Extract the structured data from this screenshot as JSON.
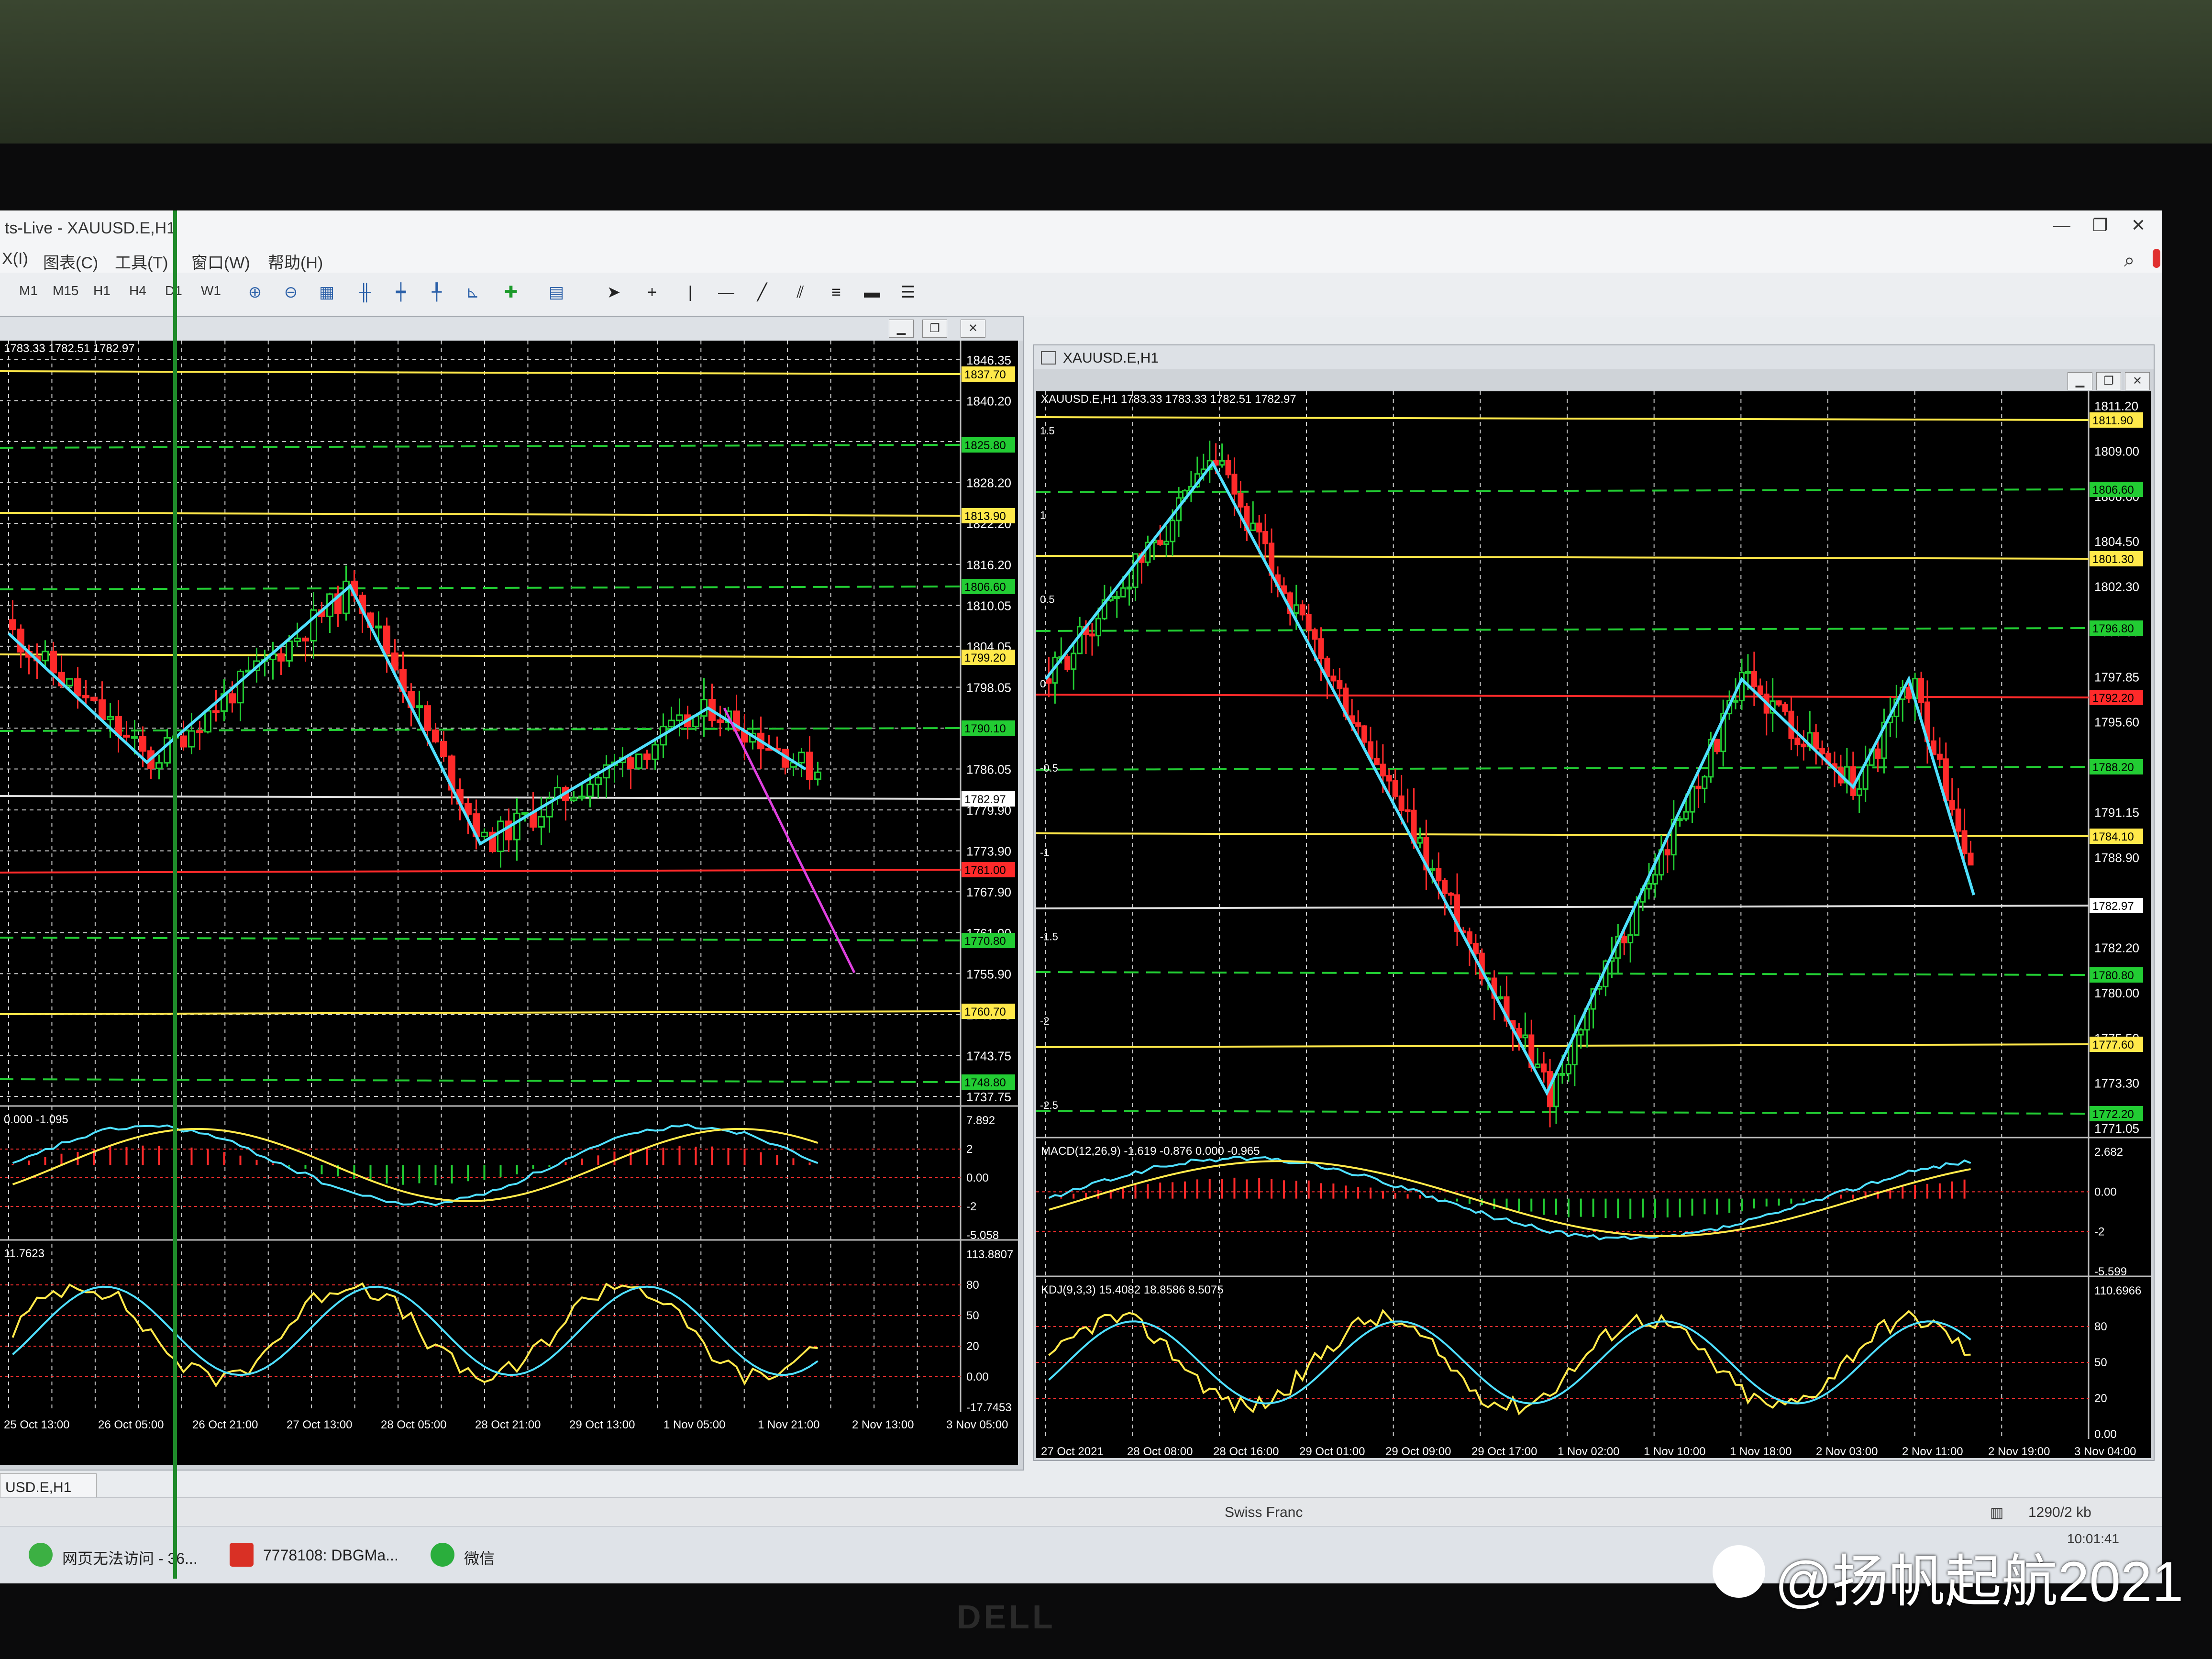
{
  "window": {
    "title": "ts-Live - XAUUSD.E,H1",
    "controls": [
      "—",
      "❐",
      "✕"
    ]
  },
  "menu": [
    "X(I)",
    "图表(C)",
    "工具(T)",
    "窗口(W)",
    "帮助(H)"
  ],
  "toolbar": {
    "timeframes": [
      "M1",
      "M15",
      "H1",
      "H4",
      "D1",
      "W1"
    ],
    "icons": [
      "zoom-in-icon",
      "zoom-out-icon",
      "tile-icon",
      "bar-chart-icon",
      "candles-icon",
      "line-chart-icon",
      "period-icon",
      "add-indicator-icon",
      "template-icon",
      "cursor-icon",
      "crosshair-icon",
      "vertical-line-icon",
      "horizontal-line-icon",
      "trendline-icon",
      "channel-icon",
      "fibo-icon",
      "rectangle-icon",
      "text-icon"
    ]
  },
  "left_chart": {
    "header": "1783.33 1782.51 1782.97",
    "price_labels": [
      "1846.35",
      "1840.20",
      "1834.20",
      "1828.20",
      "1822.20",
      "1816.20",
      "1810.05",
      "1804.05",
      "1798.05",
      "1792.05",
      "1786.05",
      "1779.90",
      "1773.90",
      "1767.90",
      "1761.90",
      "1755.90",
      "1749.75",
      "1743.75",
      "1737.75"
    ],
    "tag_labels": [
      {
        "text": "1837.70",
        "color": "#ffe94a"
      },
      {
        "text": "1825.80",
        "color": "#22cc33"
      },
      {
        "text": "1813.90",
        "color": "#ffe94a"
      },
      {
        "text": "1806.60",
        "color": "#22cc33"
      },
      {
        "text": "1799.20",
        "color": "#ffe94a"
      },
      {
        "text": "1790.10",
        "color": "#22cc33"
      },
      {
        "text": "1782.97",
        "color": "#ffffff"
      },
      {
        "text": "1781.00",
        "color": "#ff2a2a"
      },
      {
        "text": "1770.80",
        "color": "#22cc33"
      },
      {
        "text": "1760.70",
        "color": "#ffe94a"
      },
      {
        "text": "1748.80",
        "color": "#22cc33"
      }
    ],
    "macd_header": "0.000 -1.095",
    "macd_labels": [
      "7.892",
      "2",
      "0.00",
      "-2",
      "-5.058"
    ],
    "kdj_header": "11.7623",
    "kdj_labels": [
      "113.8807",
      "80",
      "50",
      "20",
      "0.00",
      "-17.7453"
    ],
    "time_labels": [
      "25 Oct 13:00",
      "26 Oct 05:00",
      "26 Oct 21:00",
      "27 Oct 13:00",
      "28 Oct 05:00",
      "28 Oct 21:00",
      "29 Oct 13:00",
      "1 Nov 05:00",
      "1 Nov 21:00",
      "2 Nov 13:00",
      "3 Nov 05:00"
    ]
  },
  "right_window": {
    "caption": "XAUUSD.E,H1",
    "header": "XAUUSD.E,H1 1783.33 1783.33 1782.51 1782.97",
    "price_labels": [
      "1811.20",
      "1809.00",
      "1806.60",
      "1804.50",
      "1802.30",
      "1800.05",
      "1797.85",
      "1795.60",
      "1793.35",
      "1791.15",
      "1788.90",
      "1786.65",
      "1782.20",
      "1780.00",
      "1775.50",
      "1773.30",
      "1771.05"
    ],
    "tag_labels": [
      {
        "text": "1811.90",
        "color": "#ffe94a"
      },
      {
        "text": "1806.60",
        "color": "#22cc33"
      },
      {
        "text": "1801.30",
        "color": "#ffe94a"
      },
      {
        "text": "1796.80",
        "color": "#22cc33"
      },
      {
        "text": "1792.20",
        "color": "#ff2a2a"
      },
      {
        "text": "1788.20",
        "color": "#22cc33"
      },
      {
        "text": "1784.10",
        "color": "#ffe94a"
      },
      {
        "text": "1782.97",
        "color": "#ffffff"
      },
      {
        "text": "1780.80",
        "color": "#22cc33"
      },
      {
        "text": "1777.60",
        "color": "#ffe94a"
      },
      {
        "text": "1772.20",
        "color": "#22cc33"
      }
    ],
    "fib_labels": [
      "1.5",
      "1",
      "0.5",
      "0",
      "-0.5",
      "-1",
      "-1.5",
      "-2",
      "-2.5"
    ],
    "macd_header": "MACD(12,26,9) -1.619 -0.876 0.000 -0.965",
    "macd_labels": [
      "2.682",
      "0.00",
      "-2",
      "-5.599"
    ],
    "kdj_header": "KDJ(9,3,3) 15.4082 18.8586 8.5075",
    "kdj_labels": [
      "110.6966",
      "80",
      "50",
      "20",
      "0.00"
    ],
    "time_labels": [
      "27 Oct 2021",
      "28 Oct 08:00",
      "28 Oct 16:00",
      "29 Oct 01:00",
      "29 Oct 09:00",
      "29 Oct 17:00",
      "1 Nov 02:00",
      "1 Nov 10:00",
      "1 Nov 18:00",
      "2 Nov 03:00",
      "2 Nov 11:00",
      "2 Nov 19:00",
      "3 Nov 04:00"
    ]
  },
  "bottom_tab": "USD.E,H1",
  "status": {
    "profile": "Swiss Franc",
    "traffic": "1290/2 kb"
  },
  "taskbar": {
    "items": [
      "网页无法访问 - 36...",
      "7778108: DBGMa...",
      "微信"
    ],
    "clock": "10:01:41"
  },
  "monitor_brand": "DELL",
  "watermark": "@扬帆起航2021",
  "colors": {
    "bull": "#22cc33",
    "bear": "#ff2a2a",
    "zigzag": "#4fe0ff",
    "yellow": "#ffe94a"
  }
}
